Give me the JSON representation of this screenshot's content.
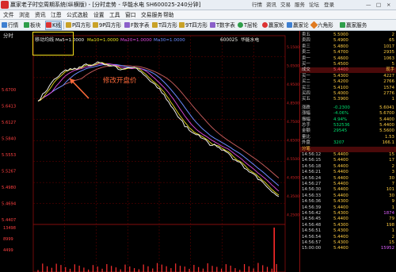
{
  "window": {
    "title": "赢家老子时空周期系统(纵横版) - [分时走势 - 华能水电  SH600025-240分钟]",
    "controls": [
      "行情",
      "资讯",
      "交易",
      "服务",
      "论坛",
      "登录",
      "—",
      "□",
      "×"
    ]
  },
  "menu": [
    "文件",
    "浏览",
    "资讯",
    "江恩",
    "公式选股",
    "设置",
    "工具",
    "窗口",
    "交易服务",
    "帮助"
  ],
  "toolbar": [
    "行情",
    "板块",
    "K线",
    "P四方形",
    "9P四方形",
    "F数字表",
    "T四方形",
    "9T四方形",
    "T数字表",
    "T层轮",
    "赢家轮",
    "赢家论",
    "六角形",
    "赢家服务"
  ],
  "chart": {
    "panel_title": "分时",
    "indicator_label": "移动均线",
    "ma": [
      "Ma5=1.0000",
      "Ma10=1.0000",
      "Ma20=1.0000",
      "Ma30=1.0000"
    ],
    "stock_code": "600025",
    "stock_name": "华能水电",
    "annotation": "修改开盘价",
    "left_price_labels": [
      "5.6700",
      "5.6413",
      "5.6127",
      "5.5840",
      "5.5553",
      "5.5267",
      "5.4980",
      "5.4694",
      "5.4407"
    ],
    "right_price_labels": [
      "5.1500",
      "5.0500",
      "4.9500",
      "4.8500",
      "4.7500",
      "4.6500",
      "4.5500",
      "4.4500",
      "4.3500",
      "4.2500"
    ],
    "volume_labels": [
      "13498",
      "8999",
      "4499"
    ],
    "colors": {
      "price": "#f0ede6",
      "ma5": "#e8e020",
      "ma10": "#e04be0",
      "ma20": "#6b8cff",
      "ma30": "#d06060",
      "volume": "#ff3030",
      "grid": "#7a0000"
    }
  },
  "chart_data": {
    "type": "line",
    "title": "华能水电 600025",
    "x": [
      0,
      3,
      6,
      9,
      12,
      15,
      18,
      21,
      24,
      27,
      30,
      33,
      36,
      39,
      42,
      45,
      48,
      51,
      54,
      57,
      60,
      63,
      66,
      69,
      72,
      75,
      78,
      81,
      84,
      87,
      90,
      93,
      96,
      99,
      102,
      105,
      108,
      111,
      114,
      117,
      120,
      123,
      126,
      129,
      132,
      135,
      138,
      141,
      144,
      147,
      150,
      153,
      156,
      159,
      162,
      165,
      168,
      171,
      174,
      177,
      180,
      183,
      186,
      189,
      192,
      195,
      198,
      201,
      204,
      207,
      210,
      213,
      216,
      219,
      222,
      225,
      228,
      231,
      234,
      237,
      240,
      243,
      246,
      249,
      252,
      255,
      258,
      261,
      264,
      267,
      270,
      273,
      276,
      279,
      282,
      285,
      288,
      291,
      294,
      297,
      300,
      303,
      306,
      309,
      312,
      315
    ],
    "series": [
      {
        "values": [
          5.578,
          5.582,
          5.595,
          5.598,
          5.604,
          5.614,
          5.622,
          5.629,
          5.632,
          5.636,
          5.643,
          5.647,
          5.651,
          5.649,
          5.654,
          5.652,
          5.655,
          5.652,
          5.658,
          5.658,
          5.663,
          5.665,
          5.661,
          5.661,
          5.663,
          5.666,
          5.67,
          5.668,
          5.667,
          5.663,
          5.663,
          5.66,
          5.66,
          5.661,
          5.659,
          5.652,
          5.651,
          5.653,
          5.654,
          5.656,
          5.656,
          5.656,
          5.657,
          5.655,
          5.649,
          5.646,
          5.64,
          5.636,
          5.63,
          5.624,
          5.621,
          5.617,
          5.609,
          5.607,
          5.597,
          5.593,
          5.582,
          5.576,
          5.566,
          5.56,
          5.551,
          5.541,
          5.536,
          5.531,
          5.518,
          5.518,
          5.509,
          5.505,
          5.502,
          5.499,
          5.499,
          5.492,
          5.49,
          5.488,
          5.482,
          5.474,
          5.474,
          5.477,
          5.471,
          5.469,
          5.463,
          5.463,
          5.459,
          5.456,
          5.45,
          5.441,
          5.44,
          5.436,
          5.435,
          5.429,
          5.42,
          5.418,
          5.412,
          5.41,
          5.407,
          5.403,
          5.394,
          5.393,
          5.388,
          5.382,
          5.376,
          5.371,
          5.365,
          5.362,
          5.357,
          5.354
        ]
      }
    ],
    "volume_ylim": [
      0,
      13498
    ]
  },
  "quote": {
    "top_rows": [
      {
        "label": "卖五",
        "price": "5.5000",
        "vol": "2"
      },
      {
        "label": "卖四",
        "price": "5.4900",
        "vol": "65"
      },
      {
        "label": "卖三",
        "price": "5.4800",
        "vol": "1017"
      },
      {
        "label": "卖二",
        "price": "5.4700",
        "vol": "2935"
      },
      {
        "label": "卖一",
        "price": "5.4600",
        "vol": "1063"
      },
      {
        "label": "买一",
        "price": "5.4500",
        "vol": "5"
      }
    ],
    "current": {
      "label": "成交",
      "price": "5.4400",
      "vol": "现手"
    },
    "bid_rows": [
      {
        "label": "买一",
        "price": "5.4300",
        "vol": "4227"
      },
      {
        "label": "买二",
        "price": "5.4200",
        "vol": "2766"
      },
      {
        "label": "买三",
        "price": "5.4100",
        "vol": "1574"
      },
      {
        "label": "买四",
        "price": "5.4000",
        "vol": "2776"
      },
      {
        "label": "买五",
        "price": "5.3900",
        "vol": "1"
      }
    ],
    "stats": [
      {
        "label": "涨跌",
        "price": "-0.2300",
        "vol": "5.6041"
      },
      {
        "label": "涨幅",
        "price": "-4.06%",
        "vol": "5.6700"
      },
      {
        "label": "振幅",
        "price": "4.94%",
        "vol": "5.4400"
      },
      {
        "label": "总手",
        "price": "532536",
        "vol": "5.4400"
      },
      {
        "label": "金额",
        "price": "29545",
        "vol": "5.5600"
      },
      {
        "label": "量比",
        "price": "",
        "vol": "1.53"
      },
      {
        "label": "外盘",
        "price": "3207",
        "vol": "166.1"
      }
    ],
    "trades_header": "分笔",
    "trades": [
      {
        "time": "14:56:12",
        "price": "5.4400",
        "vol": "15"
      },
      {
        "time": "14:56:15",
        "price": "5.4400",
        "vol": "17"
      },
      {
        "time": "14:56:18",
        "price": "5.4400",
        "vol": "2"
      },
      {
        "time": "14:56:21",
        "price": "5.4400",
        "vol": "3"
      },
      {
        "time": "14:56:24",
        "price": "5.4400",
        "vol": "30"
      },
      {
        "time": "14:56:27",
        "price": "5.4400",
        "vol": "7"
      },
      {
        "time": "14:56:30",
        "price": "5.4400",
        "vol": "101"
      },
      {
        "time": "14:56:33",
        "price": "5.4400",
        "vol": "30"
      },
      {
        "time": "14:56:36",
        "price": "5.4300",
        "vol": "9"
      },
      {
        "time": "14:56:39",
        "price": "5.4400",
        "vol": "1"
      },
      {
        "time": "14:56:42",
        "price": "5.4300",
        "vol": "1874"
      },
      {
        "time": "14:56:45",
        "price": "5.4400",
        "vol": "79"
      },
      {
        "time": "14:56:48",
        "price": "5.4300",
        "vol": "198"
      },
      {
        "time": "14:56:51",
        "price": "5.4300",
        "vol": "1"
      },
      {
        "time": "14:56:54",
        "price": "5.4400",
        "vol": "2"
      },
      {
        "time": "14:56:57",
        "price": "5.4300",
        "vol": "15"
      },
      {
        "time": "15:00:00",
        "price": "5.4400",
        "vol": "15952"
      }
    ]
  }
}
